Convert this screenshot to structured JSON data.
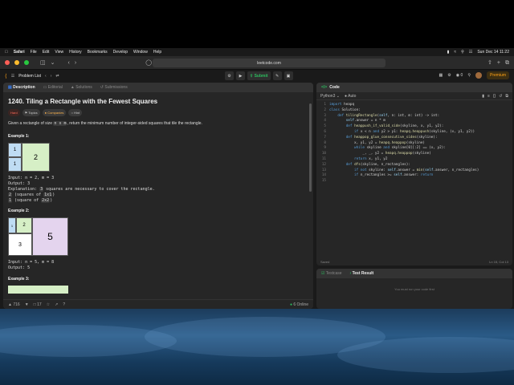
{
  "menubar": {
    "app": "Safari",
    "items": [
      "File",
      "Edit",
      "View",
      "History",
      "Bookmarks",
      "Develop",
      "Window",
      "Help"
    ],
    "clock": "Sun Dec 14  11:22"
  },
  "safari": {
    "url": "leetcode.com"
  },
  "lc_bar": {
    "problem_list": "Problem List",
    "submit": "Submit",
    "notif_count": "0",
    "premium": "Premium"
  },
  "desc_tabs": [
    "Description",
    "Editorial",
    "Solutions",
    "Submissions"
  ],
  "problem": {
    "title": "1240. Tiling a Rectangle with the Fewest Squares",
    "tags": [
      "Hard",
      "Topics",
      "Companies",
      "Hint"
    ],
    "statement_pre": "Given a rectangle of size",
    "statement_code": "n x m",
    "statement_post": ", return the minimum number of integer-sided squares that tile the rectangle.",
    "ex1_title": "Example 1:",
    "ex1_cells": [
      "1",
      "1",
      "2"
    ],
    "ex1_input": "Input: n = 2, m = 3",
    "ex1_output": "Output: 3",
    "ex1_expl_label": "Explanation:",
    "ex1_expl_code": "3",
    "ex1_expl_text": "squares are necessary to cover the rectangle.",
    "ex1_line2_num": "2",
    "ex1_line2_pre": "(squares of",
    "ex1_line2_code": "1x1",
    "ex1_line2_post": ")",
    "ex1_line3_num": "1",
    "ex1_line3_pre": "(square of",
    "ex1_line3_code": "2x2",
    "ex1_line3_post": ")",
    "ex2_title": "Example 2:",
    "ex2_cells": [
      "1",
      "2",
      "3",
      "5"
    ],
    "ex2_input": "Input: n = 5, m = 8",
    "ex2_output": "Output: 5",
    "ex3_title": "Example 3:"
  },
  "desc_footer": {
    "likes": "716",
    "comments": "17",
    "online": "6 Online"
  },
  "code": {
    "header": "Code",
    "language": "Python3",
    "mode": "Auto",
    "lines": [
      "import heapq",
      "class Solution:",
      "    def tilingRectangle(self, n: int, m: int) -> int:",
      "        self.answer = n * m",
      "        def heappush_if_valid_side(skyline, x, y1, y2):",
      "            if x < n and y2 > y1: heapq.heappush(skyline, (x, y1, y2))",
      "        def heappop_glue_consecutive_sides(skyline):",
      "            x, y1, y2 = heapq.heappop(skyline)",
      "            while skyline and skyline[0][:2] == (x, y2):",
      "                _, _, y2 = heapq.heappop(skyline)",
      "            return x, y1, y2",
      "        def dfs(skyline, n_rectangles):",
      "            if not skyline: self.answer = min(self.answer, n_rectangles)",
      "            if n_rectangles >= self.answer: return",
      ""
    ],
    "status_left": "Saved",
    "status_right": "Ln 15, Col 13"
  },
  "result": {
    "tabs": [
      "Testcase",
      "Test Result"
    ],
    "message": "You must run your code first"
  }
}
